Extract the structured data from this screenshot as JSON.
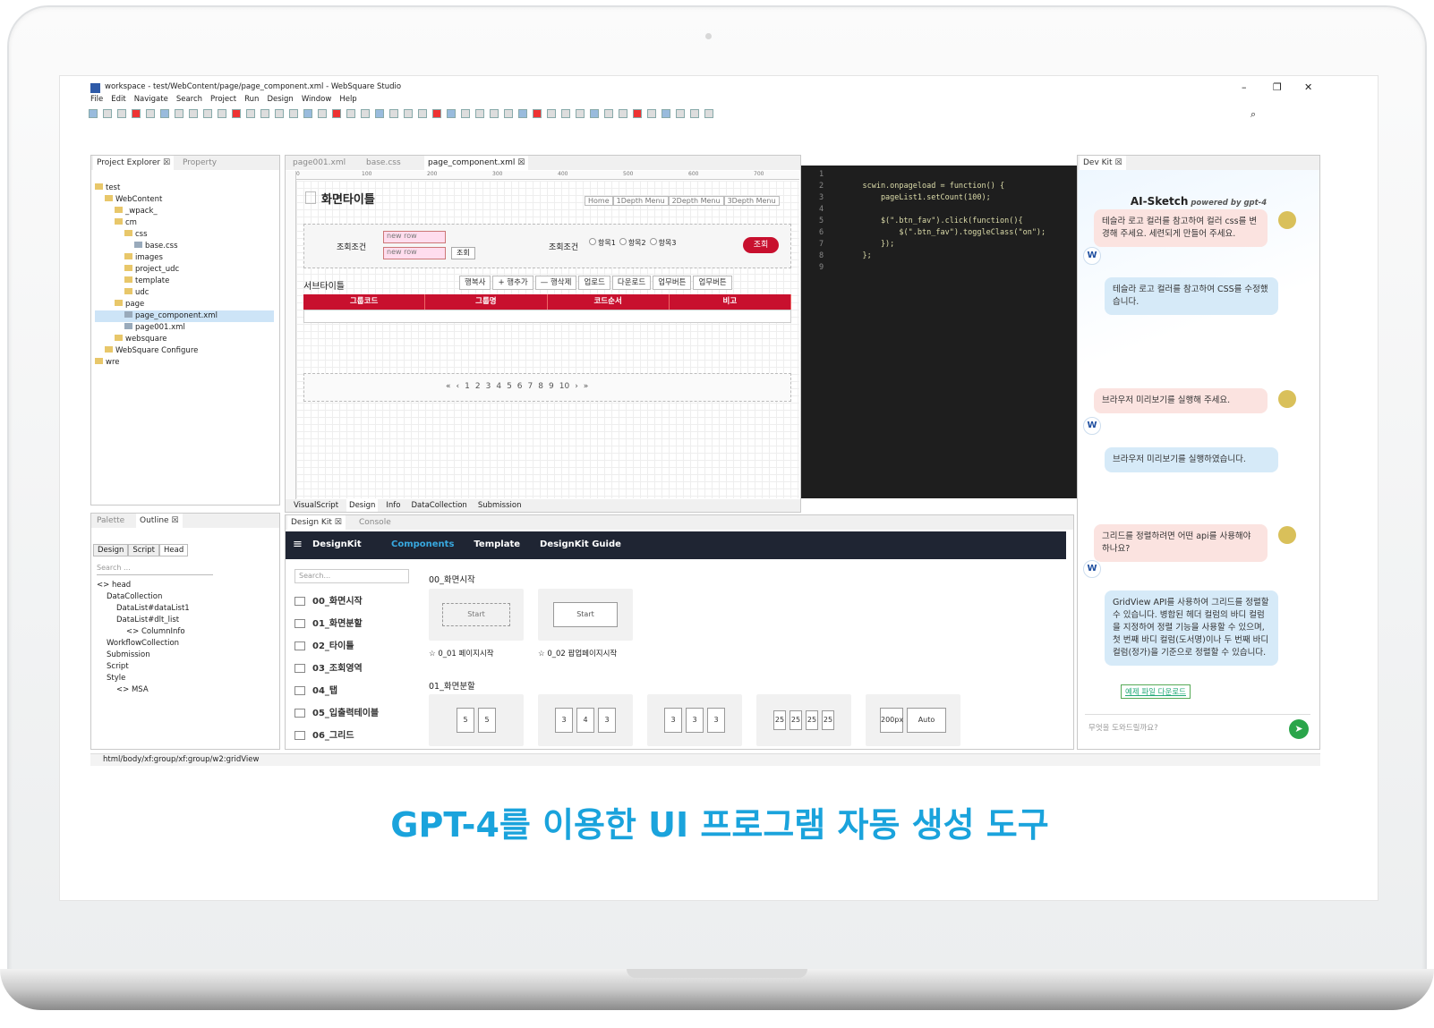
{
  "window": {
    "title": "workspace - test/WebContent/page/page_component.xml - WebSquare Studio",
    "min": "–",
    "max": "❐",
    "close": "✕"
  },
  "menu": [
    "File",
    "Edit",
    "Navigate",
    "Search",
    "Project",
    "Run",
    "Design",
    "Window",
    "Help"
  ],
  "explorer": {
    "tab1": "Project Explorer ☒",
    "tab2": "Property",
    "tree": [
      "test",
      "WebContent",
      "_wpack_",
      "cm",
      "css",
      "base.css",
      "images",
      "project_udc",
      "template",
      "udc",
      "page",
      "page_component.xml",
      "page001.xml",
      "websquare",
      "WebSquare Configure",
      "wre"
    ]
  },
  "editor": {
    "tabs": [
      "page001.xml",
      "base.css",
      "page_component.xml ☒"
    ],
    "ruler": [
      "0",
      "100",
      "200",
      "300",
      "400",
      "500",
      "600",
      "700"
    ],
    "page_title": "화면타이틀",
    "breadcrumb": [
      "Home",
      "1Depth Menu",
      "2Depth Menu",
      "3Depth Menu"
    ],
    "search_label1": "조회조건",
    "select1": "new row",
    "select2": "new row",
    "inline_btn": "조회",
    "search_label2": "조회조건",
    "radios": [
      "항목1",
      "항목2",
      "항목3"
    ],
    "search_button": "조회",
    "subtitle": "서브타이틀",
    "actions": [
      "행복사",
      "+ 행추가",
      "— 행삭제",
      "업로드",
      "다운로드",
      "업무버튼",
      "업무버튼"
    ],
    "grid_headers": [
      "그룹코드",
      "그룹명",
      "코드순서",
      "비고"
    ],
    "pager": [
      "«",
      "‹",
      "1",
      "2",
      "3",
      "4",
      "5",
      "6",
      "7",
      "8",
      "9",
      "10",
      "›",
      "»"
    ],
    "bottom_tabs": [
      "VisualScript",
      "Design",
      "Info",
      "DataCollection",
      "Submission"
    ]
  },
  "code": {
    "line_numbers": [
      "1",
      "2",
      "3",
      "4",
      "5",
      "6",
      "7",
      "8",
      "9"
    ],
    "lines": [
      "",
      "    scwin.onpageload = function() {",
      "        pageList1.setCount(100);",
      "",
      "        $(\".btn_fav\").click(function(){",
      "            $(\".btn_fav\").toggleClass(\"on\");",
      "        });",
      "    };",
      ""
    ]
  },
  "outline": {
    "tab1": "Palette",
    "tab2": "Outline ☒",
    "subtabs": [
      "Design",
      "Script",
      "Head"
    ],
    "search_placeholder": "Search ...",
    "tree": [
      "<> head",
      "DataCollection",
      "DataList#dataList1",
      "DataList#dlt_list",
      "<> ColumnInfo",
      "WorkflowCollection",
      "Submission",
      "Script",
      "Style",
      "<> MSA"
    ]
  },
  "designkit": {
    "tab1": "Design Kit ☒",
    "tab2": "Console",
    "brand": "DesignKit",
    "nav": [
      "Components",
      "Template",
      "DesignKit Guide"
    ],
    "search_placeholder": "Search...",
    "items": [
      "00_화면시작",
      "01_화면분할",
      "02_타이틀",
      "03_조회영역",
      "04_탭",
      "05_입출력테이블",
      "06_그리드"
    ],
    "section1": "00_화면시작",
    "card1_label": "Start",
    "card2_label": "Start",
    "card1_caption": "☆ 0_01 페이지시작",
    "card2_caption": "☆ 0_02 팝업페이지시작",
    "section2": "01_화면분할",
    "split_cards": [
      [
        "5",
        "5"
      ],
      [
        "3",
        "4",
        "3"
      ],
      [
        "3",
        "3",
        "3"
      ],
      [
        "25",
        "25",
        "25",
        "25"
      ],
      [
        "200px",
        "Auto"
      ]
    ]
  },
  "devkit": {
    "tab": "Dev Kit ☒",
    "title": "AI-Sketch",
    "powered": "powered by gpt-4",
    "messages": [
      {
        "role": "user",
        "text": "테슬라 로고 컬러를 참고하여 컬러 css를 변경해 주세요. 세련되게 만들어 주세요."
      },
      {
        "role": "bot",
        "text": "테슬라 로고 컬러를 참고하여 CSS를 수정했습니다."
      },
      {
        "role": "user",
        "text": "브라우저 미리보기를 실행해 주세요."
      },
      {
        "role": "bot",
        "text": "브라우저 미리보기를 실행하였습니다."
      },
      {
        "role": "user",
        "text": "그리드를 정렬하려면 어떤 api를 사용해야 하나요?"
      },
      {
        "role": "bot",
        "text": "GridView API를 사용하여 그리드를 정렬할 수 있습니다. 병합된 헤더 컬럼의 바디 컬럼을 지정하여 정렬 기능을 사용할 수 있으며, 첫 번째 바디 컬럼(도서명)이나 두 번째 바디 컬럼(정가)을 기준으로 정렬할 수 있습니다."
      }
    ],
    "download": "예제 파일 다운로드",
    "input_placeholder": "무엇을 도와드릴까요?",
    "bot_logo": "W"
  },
  "status": "html/body/xf:group/xf:group/w2:gridView",
  "caption": "GPT-4를 이용한 UI 프로그램 자동 생성 도구",
  "colors": {
    "caption": "#1aa3dc",
    "grid_header": "#c8102e",
    "code_bg": "#1e1e1e",
    "user_bubble": "#fbe3e0",
    "bot_bubble": "#d6eaf8"
  }
}
